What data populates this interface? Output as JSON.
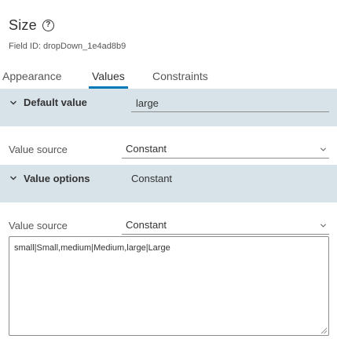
{
  "header": {
    "title": "Size",
    "help_icon": "?",
    "field_id": "Field ID: dropDown_1e4ad8b9"
  },
  "tabs": [
    {
      "label": "Appearance",
      "active": false
    },
    {
      "label": "Values",
      "active": true
    },
    {
      "label": "Constraints",
      "active": false
    }
  ],
  "default_value": {
    "section_title": "Default value",
    "value": "large",
    "value_source_label": "Value source",
    "value_source": "Constant"
  },
  "value_options": {
    "section_title": "Value options",
    "summary": "Constant",
    "value_source_label": "Value source",
    "value_source": "Constant",
    "options_text": "small|Small,medium|Medium,large|Large"
  },
  "colors": {
    "accent": "#0079b8",
    "section_bg": "#d8e3e9"
  },
  "icons": {
    "help": "help-circle-icon",
    "section_toggle": "chevron-down-icon",
    "select_caret": "chevron-down-icon",
    "resize": "resize-grip-icon"
  }
}
